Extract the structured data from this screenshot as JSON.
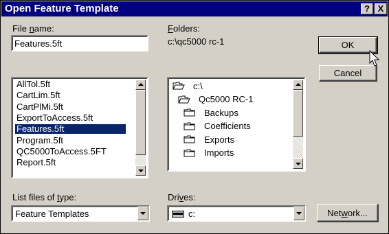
{
  "window": {
    "title": "Open Feature Template"
  },
  "titlebar_buttons": {
    "help": "?",
    "close": "X"
  },
  "file_name": {
    "label_pre": "File ",
    "label_u": "n",
    "label_post": "ame:",
    "value": "Features.5ft"
  },
  "files": [
    {
      "name": "AllTol.5ft",
      "selected": false
    },
    {
      "name": "CartLim.5ft",
      "selected": false
    },
    {
      "name": "CartPlMi.5ft",
      "selected": false
    },
    {
      "name": "ExportToAccess.5ft",
      "selected": false
    },
    {
      "name": "Features.5ft",
      "selected": true
    },
    {
      "name": "Program.5ft",
      "selected": false
    },
    {
      "name": "QC5000ToAccess.5FT",
      "selected": false
    },
    {
      "name": "Report.5ft",
      "selected": false
    }
  ],
  "folders": {
    "label_u": "F",
    "label_post": "olders:",
    "path": "c:\\qc5000 rc-1",
    "items": [
      {
        "name": "c:\\",
        "level": 0,
        "icon": "open-folder-icon"
      },
      {
        "name": "Qc5000 RC-1",
        "level": 1,
        "icon": "open-folder-icon"
      },
      {
        "name": "Backups",
        "level": 2,
        "icon": "folder-icon"
      },
      {
        "name": "Coefficients",
        "level": 2,
        "icon": "folder-icon"
      },
      {
        "name": "Exports",
        "level": 2,
        "icon": "folder-icon"
      },
      {
        "name": "Imports",
        "level": 2,
        "icon": "folder-icon"
      }
    ]
  },
  "buttons": {
    "ok": "OK",
    "cancel": "Cancel",
    "network_pre": "Net",
    "network_u": "w",
    "network_post": "ork..."
  },
  "file_type": {
    "label_pre": "List files of ",
    "label_u": "t",
    "label_post": "ype:",
    "value": "Feature Templates"
  },
  "drives": {
    "label_pre": "Dri",
    "label_u": "v",
    "label_post": "es:",
    "value": "c:"
  }
}
